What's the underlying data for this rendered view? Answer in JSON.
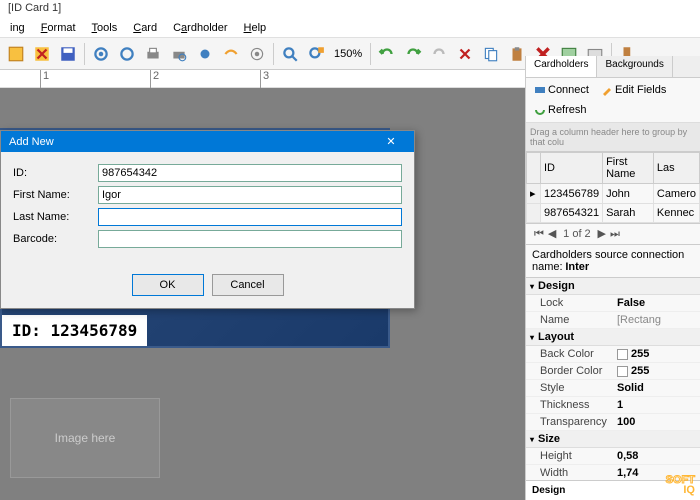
{
  "title": "[ID Card 1]",
  "menu": {
    "m0": "ing",
    "m1": "Format",
    "m2": "Tools",
    "m3": "Card",
    "m4": "Cardholder",
    "m5": "Help"
  },
  "zoom": "150%",
  "ruler": {
    "t1": "1",
    "t2": "2",
    "t3": "3"
  },
  "card": {
    "id_label": "ID: 123456789"
  },
  "placeholder": "Image here",
  "dialog": {
    "title": "Add New",
    "labels": {
      "id": "ID:",
      "first": "First Name:",
      "last": "Last Name:",
      "barcode": "Barcode:"
    },
    "values": {
      "id": "987654342",
      "first": "Igor",
      "last": "",
      "barcode": ""
    },
    "ok": "OK",
    "cancel": "Cancel"
  },
  "rp": {
    "tabs": {
      "t0": "Cardholders",
      "t1": "Backgrounds"
    },
    "tb": {
      "connect": "Connect",
      "edit": "Edit Fields",
      "refresh": "Refresh"
    },
    "hint": "Drag a column header here to group by that colu",
    "cols": {
      "c0": "ID",
      "c1": "First Name",
      "c2": "Las"
    },
    "rows": [
      {
        "id": "123456789",
        "fn": "John",
        "ln": "Camero"
      },
      {
        "id": "987654321",
        "fn": "Sarah",
        "ln": "Kennec"
      }
    ],
    "pager": "1 of 2",
    "src_label": "Cardholders source connection name:",
    "src_val": "Inter"
  },
  "props": {
    "cat_design": "Design",
    "lock_n": "Lock",
    "lock_v": "False",
    "name_n": "Name",
    "name_v": "[Rectang",
    "cat_layout": "Layout",
    "back_n": "Back Color",
    "back_v": "255",
    "border_n": "Border Color",
    "border_v": "255",
    "style_n": "Style",
    "style_v": "Solid",
    "thick_n": "Thickness",
    "thick_v": "1",
    "trans_n": "Transparency",
    "trans_v": "100",
    "cat_size": "Size",
    "height_n": "Height",
    "height_v": "0,58",
    "width_n": "Width",
    "width_v": "1,74",
    "footer": "Design"
  },
  "wm": {
    "l1": "SOFT",
    "l2": "IQ"
  }
}
